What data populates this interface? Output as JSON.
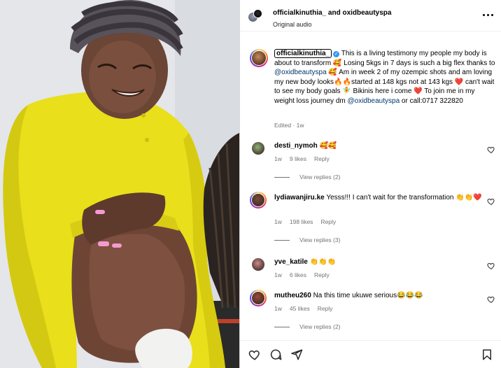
{
  "header": {
    "title": "officialkinuthia_ and oxidbeautyspa",
    "subtitle": "Original audio",
    "more_icon": "more-horizontal-icon"
  },
  "caption": {
    "username": "officialkinuthia_",
    "verified_icon": "verified-badge-icon",
    "segments": [
      {
        "type": "text",
        "value": " This is a living testimony my people my body is about to transform 🥰 Losing 5kgs in 7 days is such a big flex thanks to "
      },
      {
        "type": "mention",
        "value": "@oxidbeautyspa"
      },
      {
        "type": "text",
        "value": " 🥰 Am in week 2 of my ozempic shots and am loving my new body looks🔥🔥started at 148 kgs not at 143 kgs ❤️ can't wait to see my body goals 🧚 Bikinis here i come ❤️ To join me in my weight loss journey dm "
      },
      {
        "type": "mention",
        "value": "@oxidbeautyspa"
      },
      {
        "type": "text",
        "value": " or call:0717 322820"
      }
    ],
    "meta": "Edited · 1w"
  },
  "comments": [
    {
      "username": "desti_nymoh",
      "text": "🥰🥰",
      "time": "1w",
      "likes": "9 likes",
      "reply": "Reply",
      "view_replies": "View replies (2)",
      "avatar_color": "#8fb27a",
      "ring": false
    },
    {
      "username": "lydiawanjiru.ke",
      "text": "Yesss!!! I can't wait for the transformation 👏👏❤️",
      "time": "1w",
      "likes": "198 likes",
      "reply": "Reply",
      "view_replies": "View replies (3)",
      "avatar_color": "#7a4a3a",
      "ring": true
    },
    {
      "username": "yve_katile",
      "text": "👏👏👏",
      "time": "1w",
      "likes": "6 likes",
      "reply": "Reply",
      "view_replies": "",
      "avatar_color": "#c98a8a",
      "ring": false
    },
    {
      "username": "mutheu260",
      "text": "Na this time ukuwe serious😂😂😂",
      "time": "1w",
      "likes": "45 likes",
      "reply": "Reply",
      "view_replies": "View replies (2)",
      "avatar_color": "#9a4a3a",
      "ring": true
    }
  ],
  "actions": {
    "like_icon": "heart-icon",
    "comment_icon": "comment-icon",
    "share_icon": "share-icon",
    "save_icon": "bookmark-icon"
  },
  "colors": {
    "garment": "#e6dd1a",
    "mention": "#00376b",
    "muted": "#737373",
    "verified": "#3897f0"
  }
}
